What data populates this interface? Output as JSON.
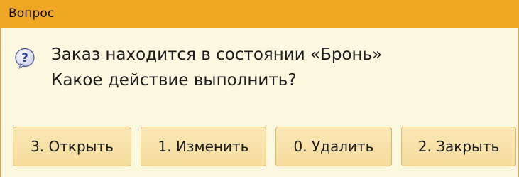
{
  "window": {
    "title": "Вопрос"
  },
  "message": {
    "line1": "Заказ находится в состоянии «Бронь»",
    "line2": "Какое действие выполнить?",
    "icon": "question-icon",
    "icon_glyph": "?"
  },
  "buttons": {
    "open_label": "3. Открыть",
    "edit_label": "1. Изменить",
    "delete_label": "0. Удалить",
    "close_label": "2. Закрыть"
  },
  "colors": {
    "titlebar": "#f0a824",
    "background": "#fcf8df",
    "button": "#f8e2aa",
    "button_border": "#dcb86c",
    "icon_blue": "#2b3fa8",
    "icon_fill": "#f2f3fa"
  }
}
